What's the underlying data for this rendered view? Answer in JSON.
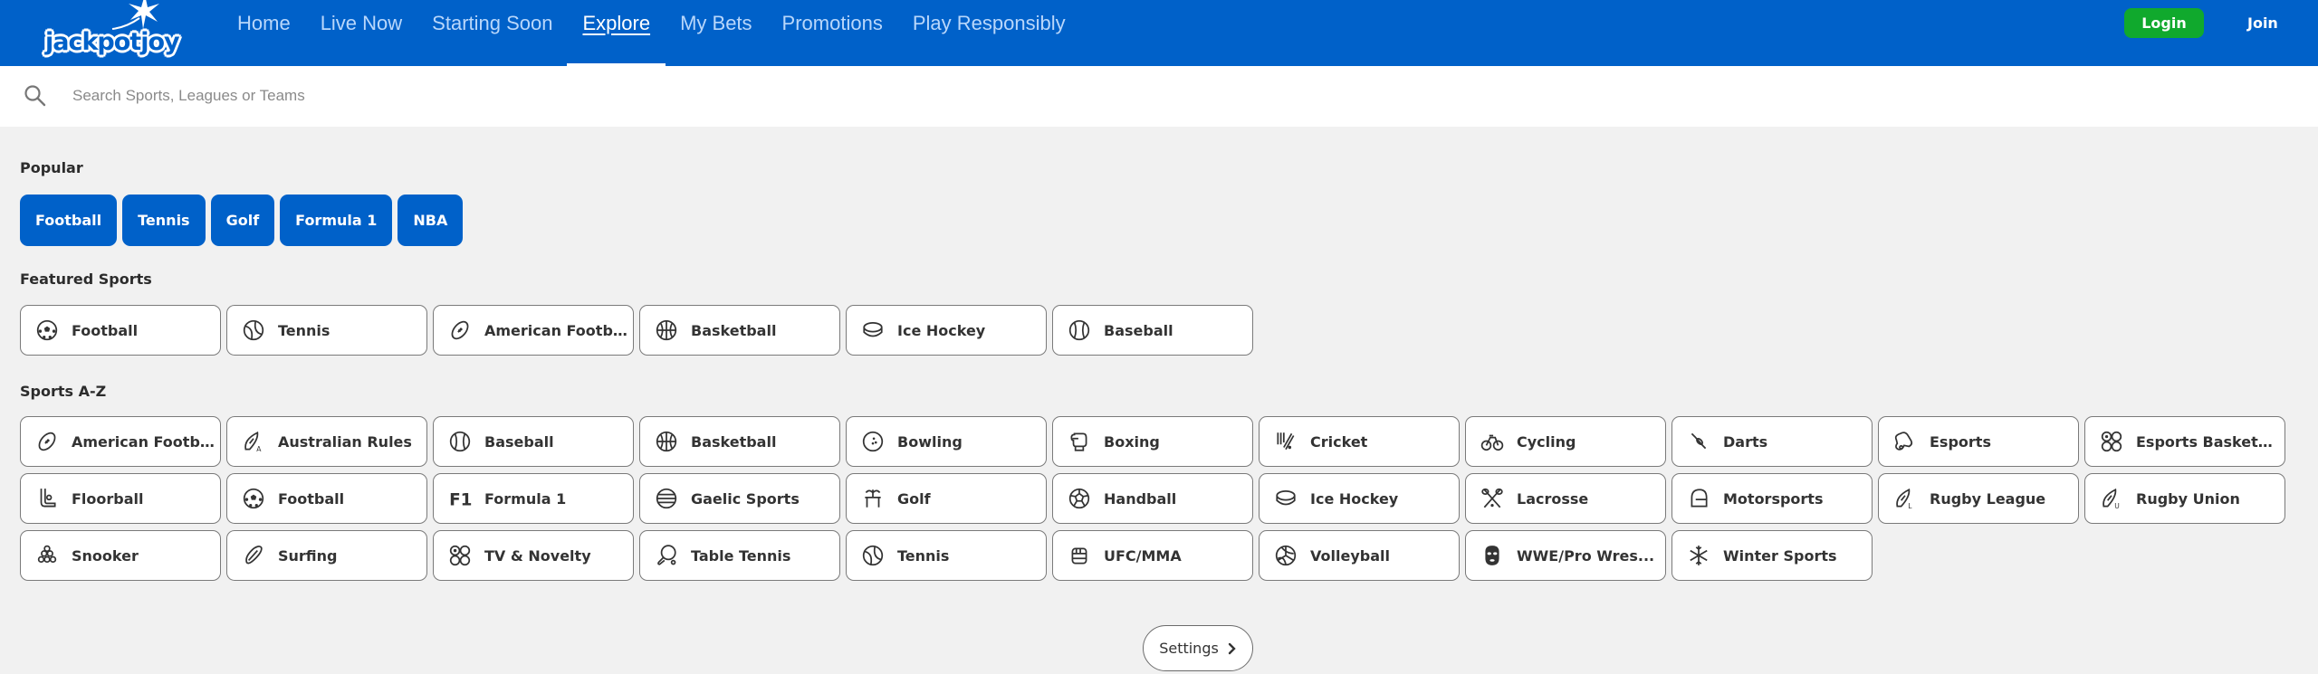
{
  "header": {
    "logo_text": "jackpotjoy",
    "nav": [
      {
        "label": "Home",
        "active": false
      },
      {
        "label": "Live Now",
        "active": false
      },
      {
        "label": "Starting Soon",
        "active": false
      },
      {
        "label": "Explore",
        "active": true
      },
      {
        "label": "My Bets",
        "active": false
      },
      {
        "label": "Promotions",
        "active": false
      },
      {
        "label": "Play Responsibly",
        "active": false
      }
    ],
    "login_label": "Login",
    "join_label": "Join"
  },
  "search": {
    "placeholder": "Search Sports, Leagues or Teams",
    "value": ""
  },
  "popular": {
    "title": "Popular",
    "items": [
      "Football",
      "Tennis",
      "Golf",
      "Formula 1",
      "NBA"
    ]
  },
  "featured": {
    "title": "Featured Sports",
    "items": [
      {
        "label": "Football",
        "icon": "football-icon"
      },
      {
        "label": "Tennis",
        "icon": "tennis-icon"
      },
      {
        "label": "American Footb...",
        "icon": "american-football-icon"
      },
      {
        "label": "Basketball",
        "icon": "basketball-icon"
      },
      {
        "label": "Ice Hockey",
        "icon": "ice-hockey-icon"
      },
      {
        "label": "Baseball",
        "icon": "baseball-icon"
      }
    ]
  },
  "az": {
    "title": "Sports A-Z",
    "items": [
      {
        "label": "American Footb...",
        "icon": "american-football-icon"
      },
      {
        "label": "Australian Rules",
        "icon": "australian-rules-icon"
      },
      {
        "label": "Baseball",
        "icon": "baseball-icon"
      },
      {
        "label": "Basketball",
        "icon": "basketball-icon"
      },
      {
        "label": "Bowling",
        "icon": "bowling-icon"
      },
      {
        "label": "Boxing",
        "icon": "boxing-icon"
      },
      {
        "label": "Cricket",
        "icon": "cricket-icon"
      },
      {
        "label": "Cycling",
        "icon": "cycling-icon"
      },
      {
        "label": "Darts",
        "icon": "darts-icon"
      },
      {
        "label": "Esports",
        "icon": "esports-icon"
      },
      {
        "label": "Esports Basketb...",
        "icon": "esports-basketball-icon"
      },
      {
        "label": "Floorball",
        "icon": "floorball-icon"
      },
      {
        "label": "Football",
        "icon": "football-icon"
      },
      {
        "label": "Formula 1",
        "icon": "formula-1-icon"
      },
      {
        "label": "Gaelic Sports",
        "icon": "gaelic-sports-icon"
      },
      {
        "label": "Golf",
        "icon": "golf-icon"
      },
      {
        "label": "Handball",
        "icon": "handball-icon"
      },
      {
        "label": "Ice Hockey",
        "icon": "ice-hockey-icon"
      },
      {
        "label": "Lacrosse",
        "icon": "lacrosse-icon"
      },
      {
        "label": "Motorsports",
        "icon": "motorsports-icon"
      },
      {
        "label": "Rugby League",
        "icon": "rugby-league-icon"
      },
      {
        "label": "Rugby Union",
        "icon": "rugby-union-icon"
      },
      {
        "label": "Snooker",
        "icon": "snooker-icon"
      },
      {
        "label": "Surfing",
        "icon": "surfing-icon"
      },
      {
        "label": "TV & Novelty",
        "icon": "tv-novelty-icon"
      },
      {
        "label": "Table Tennis",
        "icon": "table-tennis-icon"
      },
      {
        "label": "Tennis",
        "icon": "tennis-icon"
      },
      {
        "label": "UFC/MMA",
        "icon": "ufc-mma-icon"
      },
      {
        "label": "Volleyball",
        "icon": "volleyball-icon"
      },
      {
        "label": "WWE/Pro Wres...",
        "icon": "wwe-icon"
      },
      {
        "label": "Winter Sports",
        "icon": "winter-sports-icon"
      }
    ]
  },
  "settings": {
    "label": "Settings"
  },
  "colors": {
    "brand_blue": "#0061c9",
    "login_green": "#10a92d",
    "page_bg": "#f1f1f1"
  }
}
